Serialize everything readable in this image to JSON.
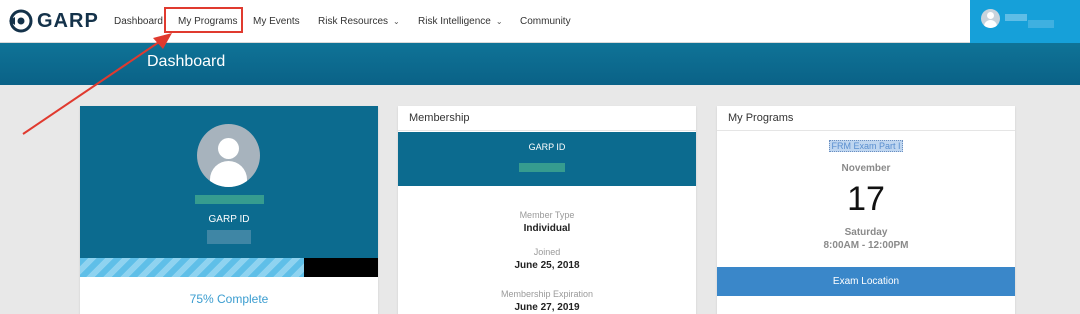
{
  "brand": {
    "logo_text": "GARP"
  },
  "nav": {
    "items": [
      {
        "label": "Dashboard"
      },
      {
        "label": "My Programs"
      },
      {
        "label": "My Events"
      },
      {
        "label": "Risk Resources",
        "dropdown": true
      },
      {
        "label": "Risk Intelligence",
        "dropdown": true
      },
      {
        "label": "Community"
      }
    ],
    "highlighted_item": "My Programs"
  },
  "page": {
    "title": "Dashboard"
  },
  "profile_card": {
    "id_label": "GARP ID",
    "progress": 0.75,
    "complete_label": "75% Complete"
  },
  "membership_card": {
    "header": "Membership",
    "id_label": "GARP ID",
    "member_type_label": "Member Type",
    "member_type_value": "Individual",
    "joined_label": "Joined",
    "joined_value": "June 25, 2018",
    "expiration_label": "Membership Expiration",
    "expiration_value": "June 27, 2019"
  },
  "programs_card": {
    "header": "My Programs",
    "exam_name": "FRM Exam Part I",
    "month": "November",
    "day": "17",
    "weekday": "Saturday",
    "time": "8:00AM - 12:00PM",
    "location_button": "Exam Location"
  },
  "colors": {
    "header_blue": "#0c6b8f",
    "accent_blue": "#16a0d9",
    "button_blue": "#3a87c9",
    "annotation_red": "#e03a2f"
  },
  "icons": [
    "garp-logo-icon",
    "chevron-down-icon",
    "user-avatar-icon"
  ]
}
